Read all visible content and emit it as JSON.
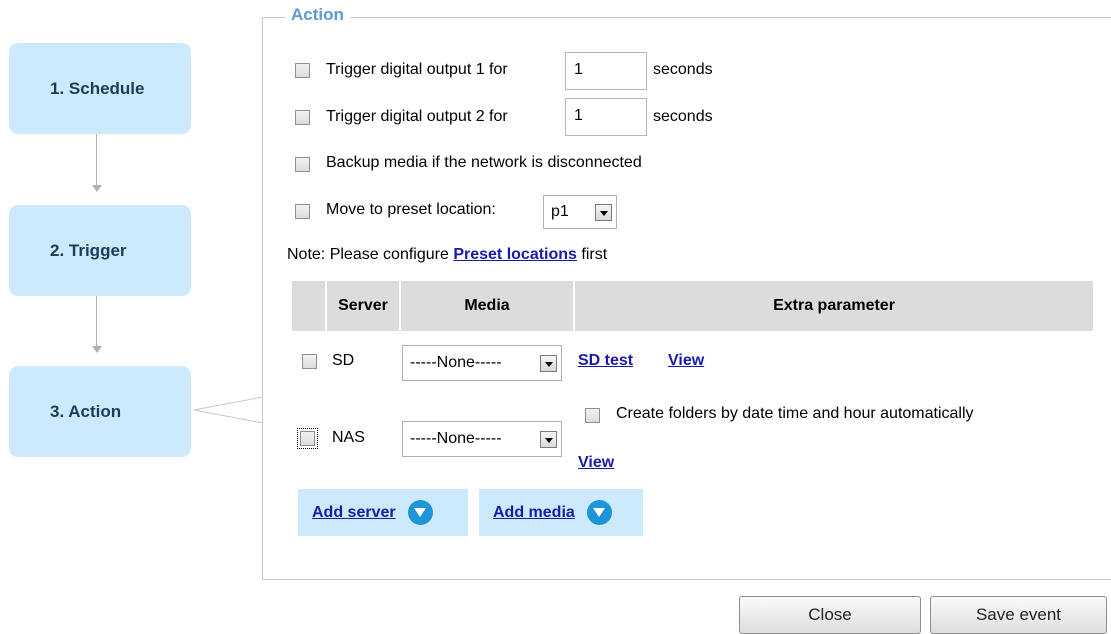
{
  "steps": [
    {
      "label": "1.  Schedule"
    },
    {
      "label": "2.  Trigger"
    },
    {
      "label": "3.  Action"
    }
  ],
  "action": {
    "legend": "Action",
    "do1": {
      "checked": false,
      "label": "Trigger digital output 1 for",
      "value": "1",
      "unit": "seconds"
    },
    "do2": {
      "checked": false,
      "label": "Trigger digital output 2 for",
      "value": "1",
      "unit": "seconds"
    },
    "backup": {
      "checked": false,
      "label": "Backup media if the network is disconnected"
    },
    "preset": {
      "checked": false,
      "label": "Move to preset location:",
      "selected": "p1"
    },
    "note": {
      "prefix": "Note: Please configure ",
      "link": "Preset locations",
      "suffix": " first"
    },
    "table": {
      "headers": {
        "server": "Server",
        "media": "Media",
        "extra": "Extra parameter"
      },
      "rows": [
        {
          "checked": false,
          "server": "SD",
          "media": "-----None-----",
          "extra_link": "SD test",
          "view": "View"
        },
        {
          "checked": false,
          "server": "NAS",
          "media": "-----None-----",
          "extra_option": "Create folders by date time and hour automatically",
          "view": "View"
        }
      ]
    },
    "add_server": "Add server",
    "add_media": "Add media"
  },
  "footer": {
    "close": "Close",
    "save": "Save event"
  },
  "colors": {
    "step_bg": "#cdeafc",
    "legend": "#5b9bd5",
    "link": "#1a1aa8",
    "header_bg": "#dcdcdc",
    "add_icon": "#1e95d8"
  }
}
